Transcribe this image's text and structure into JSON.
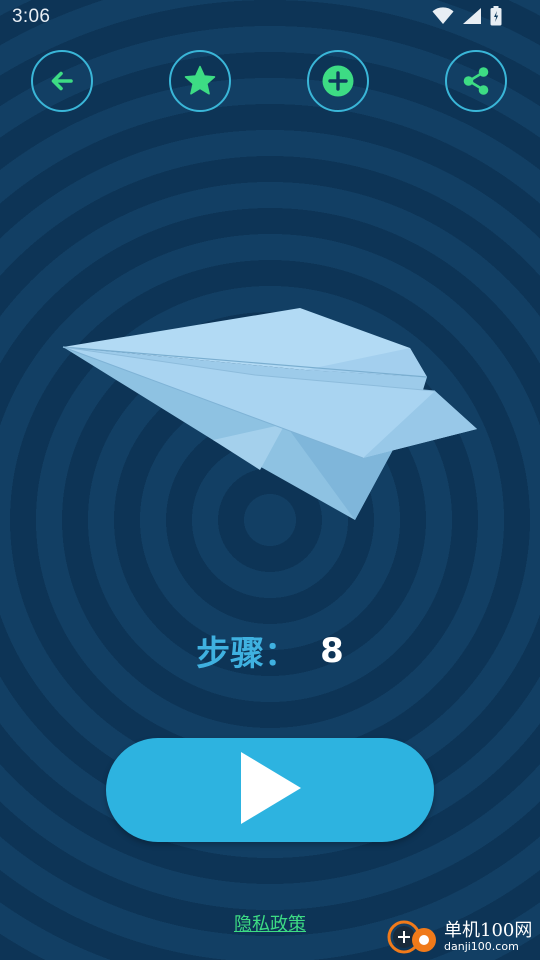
{
  "status_bar": {
    "time": "3:06",
    "icons": [
      "wifi-icon",
      "signal-icon",
      "battery-icon"
    ]
  },
  "toolbar": {
    "buttons": [
      {
        "name": "back-button",
        "icon": "arrow-left-icon"
      },
      {
        "name": "favorite-button",
        "icon": "star-icon"
      },
      {
        "name": "add-button",
        "icon": "plus-circle-icon"
      },
      {
        "name": "share-button",
        "icon": "share-icon"
      }
    ]
  },
  "model": {
    "illustration": "paper-airplane"
  },
  "step": {
    "label": "步骤：",
    "value": "8"
  },
  "play_button": {
    "icon": "play-icon"
  },
  "footer": {
    "privacy_link": "隐私政策"
  },
  "watermark": {
    "name_cn": "单机100网",
    "domain": "danji100.com"
  },
  "colors": {
    "background": "#0f3a5c",
    "accent_cyan": "#3ab6d8",
    "accent_green": "#3ddc84",
    "play_button": "#2db3e0",
    "step_label": "#3fb1e0"
  }
}
